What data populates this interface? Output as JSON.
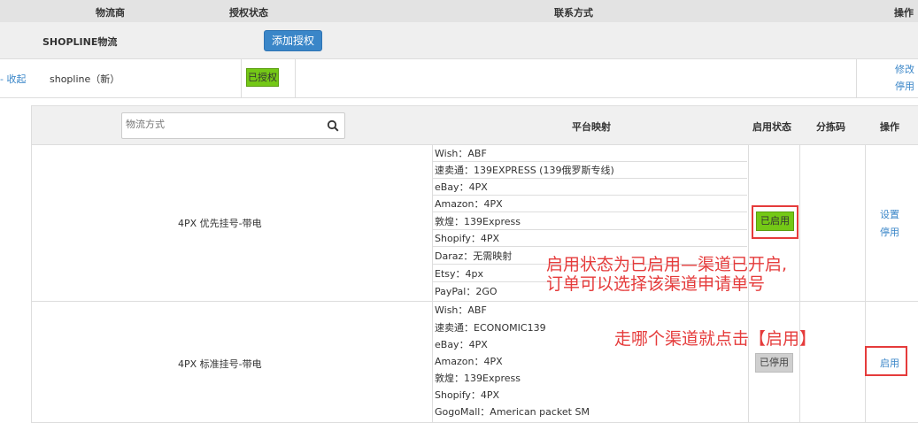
{
  "header": {
    "provider": "物流商",
    "auth_status": "授权状态",
    "contact": "联系方式",
    "operations": "操作"
  },
  "provider": {
    "name": "SHOPLINE物流",
    "add_auth_button": "添加授权"
  },
  "account": {
    "collapse": "- 收起",
    "name": "shopline（新）",
    "status": "已授权",
    "edit": "修改",
    "disable": "停用"
  },
  "inner_table": {
    "search_placeholder": "物流方式",
    "headers": {
      "platform_mapping": "平台映射",
      "enable_status": "启用状态",
      "sort_code": "分拣码",
      "operations": "操作"
    },
    "rows": [
      {
        "method": "4PX 优先挂号-带电",
        "mappings": [
          "Wish：ABF",
          "速卖通：139EXPRESS (139俄罗斯专线)",
          "eBay：4PX",
          "Amazon：4PX",
          "敦煌：139Express",
          "Shopify：4PX",
          "Daraz：无需映射",
          "Etsy：4px",
          "PayPal：2GO"
        ],
        "status": "已启用",
        "ops": [
          "设置",
          "停用"
        ]
      },
      {
        "method": "4PX 标准挂号-带电",
        "mappings": [
          "Wish：ABF",
          "速卖通：ECONOMIC139",
          "eBay：4PX",
          "Amazon：4PX",
          "敦煌：139Express",
          "Shopify：4PX",
          "GogoMall：American packet SM"
        ],
        "status": "已停用",
        "ops": [
          "启用"
        ]
      }
    ]
  },
  "annotations": {
    "note1_line1": "启用状态为已启用—渠道已开启,",
    "note1_line2": "订单可以选择该渠道申请单号",
    "note2": "走哪个渠道就点击【启用】"
  },
  "colors": {
    "link": "#3a86c8",
    "enabled_badge": "#74c816",
    "disabled_badge": "#cfcfcf",
    "annotation": "#e53b3b"
  }
}
